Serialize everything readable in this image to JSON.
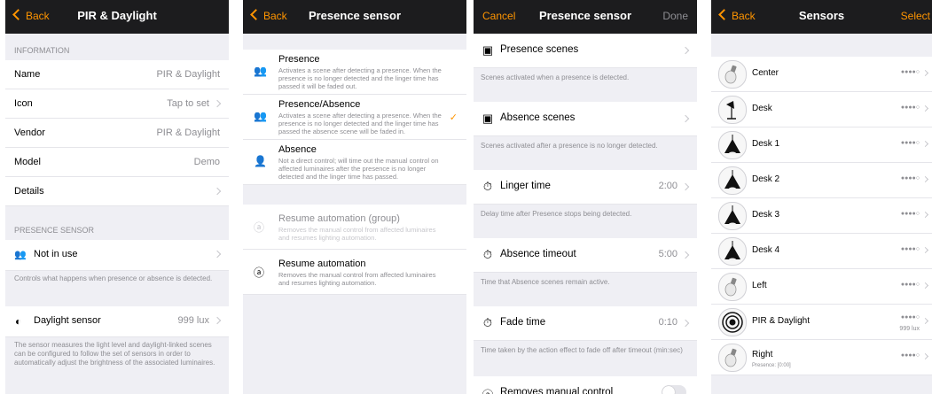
{
  "accent": "#ff9500",
  "panel1": {
    "back": "Back",
    "title": "PIR & Daylight",
    "info_header": "INFORMATION",
    "rows": [
      {
        "label": "Name",
        "value": "PIR & Daylight"
      },
      {
        "label": "Icon",
        "value": "Tap to set"
      },
      {
        "label": "Vendor",
        "value": "PIR & Daylight"
      },
      {
        "label": "Model",
        "value": "Demo"
      },
      {
        "label": "Details",
        "value": ""
      }
    ],
    "presence_header": "PRESENCE SENSOR",
    "presence_row": {
      "label": "Not in use",
      "icon": "people-icon"
    },
    "presence_note": "Controls what happens when presence or absence is detected.",
    "daylight_row": {
      "label": "Daylight sensor",
      "value": "999 lux",
      "icon": "daylight-icon"
    },
    "daylight_note": "The sensor measures the light level and daylight-linked scenes can be configured to follow the set of sensors in order to automatically adjust the brightness of the associated luminaires."
  },
  "panel2": {
    "back": "Back",
    "title": "Presence sensor",
    "options": [
      {
        "title": "Presence",
        "desc": "Activates a scene after detecting a presence. When the presence is no longer detected and the linger time has passed it will be faded out."
      },
      {
        "title": "Presence/Absence",
        "desc": "Activates a scene after detecting a presence. When the presence is no longer detected and the linger time has passed the absence scene will be faded in.",
        "check": "✓"
      },
      {
        "title": "Absence",
        "desc": "Not a direct control; will time out the manual control on affected luminaires after the presence is no longer detected and the linger time has passed."
      }
    ],
    "resume_group": {
      "title": "Resume automation (group)",
      "desc": "Removes the manual control from affected luminaires and resumes lighting automation."
    },
    "resume": {
      "title": "Resume automation",
      "desc": "Removes the manual control from affected luminaires and resumes lighting automation."
    }
  },
  "panel3": {
    "cancel": "Cancel",
    "title": "Presence sensor",
    "done": "Done",
    "presence_scenes": "Presence scenes",
    "presence_scenes_note": "Scenes activated when a presence is detected.",
    "absence_scenes": "Absence scenes",
    "absence_scenes_note": "Scenes activated after a presence is no longer detected.",
    "linger": {
      "label": "Linger time",
      "value": "2:00"
    },
    "linger_note": "Delay time after Presence stops being detected.",
    "absence_timeout": {
      "label": "Absence timeout",
      "value": "5:00"
    },
    "absence_timeout_note": "Time that Absence scenes remain active.",
    "fade": {
      "label": "Fade time",
      "value": "0:10"
    },
    "fade_note": "Time taken by the action effect to fade off after timeout (min:sec)",
    "removes": "Removes manual control"
  },
  "panel4": {
    "back": "Back",
    "title": "Sensors",
    "select": "Select",
    "sensors": [
      {
        "name": "Center",
        "signal": "●●●●○",
        "icon": "bulb-icon"
      },
      {
        "name": "Desk",
        "signal": "●●●●○",
        "icon": "desk-lamp-icon"
      },
      {
        "name": "Desk 1",
        "signal": "●●●●○",
        "icon": "pendant-lamp-icon"
      },
      {
        "name": "Desk 2",
        "signal": "●●●●○",
        "icon": "pendant-lamp-icon"
      },
      {
        "name": "Desk 3",
        "signal": "●●●●○",
        "icon": "pendant-lamp-icon"
      },
      {
        "name": "Desk 4",
        "signal": "●●●●○",
        "icon": "pendant-lamp-icon"
      },
      {
        "name": "Left",
        "signal": "●●●●○",
        "icon": "bulb-icon"
      },
      {
        "name": "PIR & Daylight",
        "signal": "●●●●○",
        "lux": "999 lux",
        "icon": "sensor-icon"
      },
      {
        "name": "Right",
        "signal": "●●●●○",
        "sub": "Presence: [0:00]",
        "icon": "bulb-icon"
      }
    ]
  }
}
